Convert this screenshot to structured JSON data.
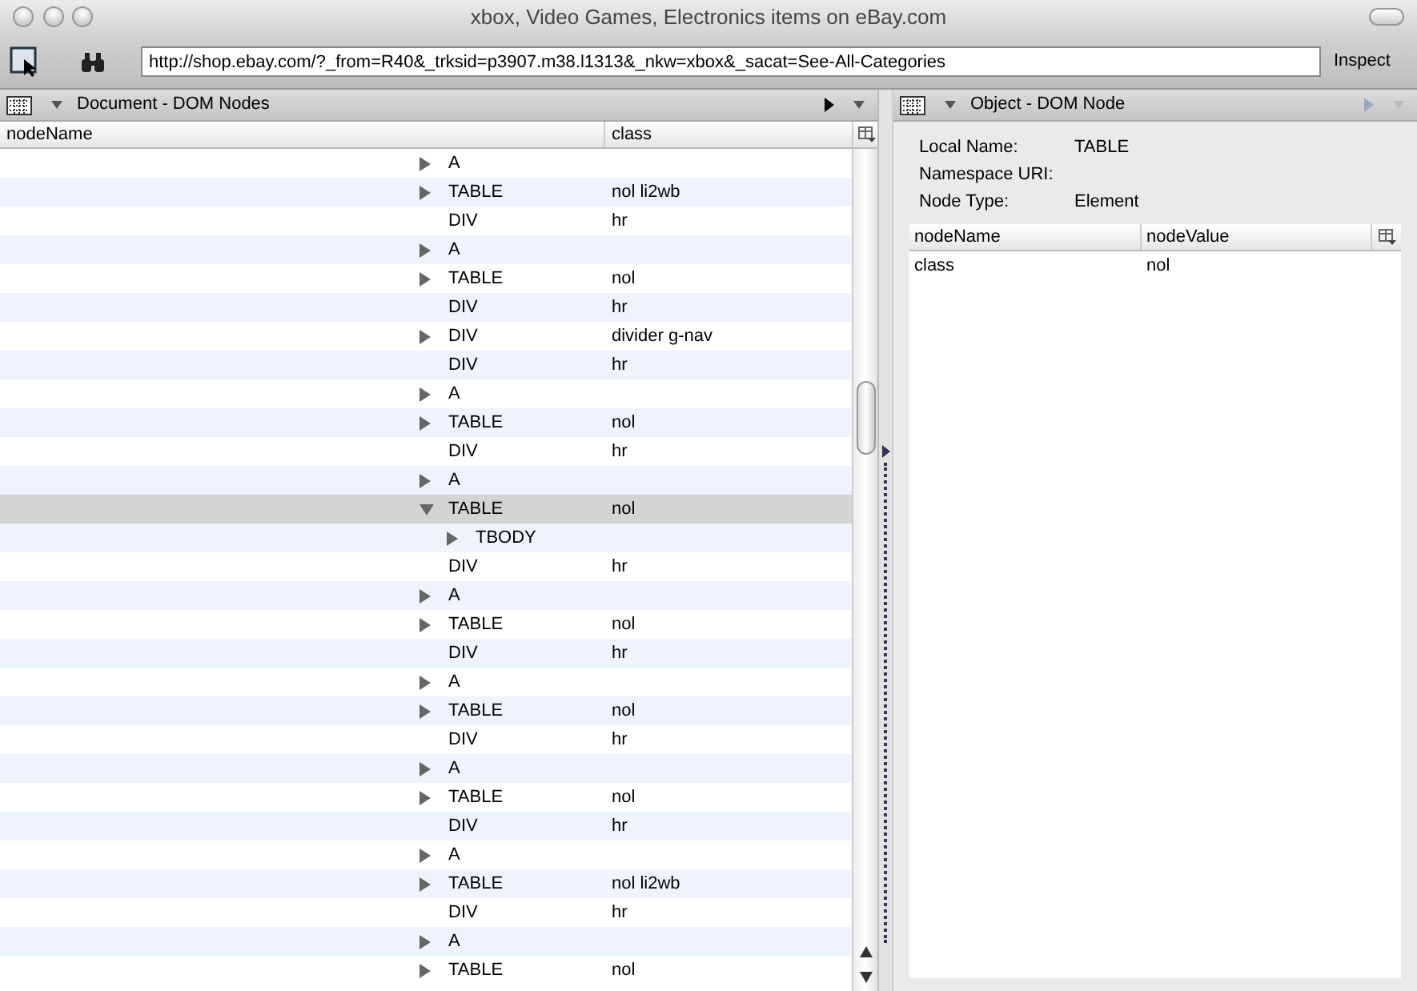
{
  "window": {
    "title": "xbox, Video Games, Electronics items on eBay.com"
  },
  "toolbar": {
    "url": "http://shop.ebay.com/?_from=R40&_trksid=p3907.m38.l1313&_nkw=xbox&_sacat=See-All-Categories",
    "inspect_label": "Inspect"
  },
  "left_pane": {
    "title": "Document - DOM Nodes",
    "columns": [
      "nodeName",
      "class"
    ],
    "rows": [
      {
        "node": "A",
        "kind": "branch",
        "expanded": false,
        "selected": false
      },
      {
        "node": "TABLE",
        "class": "nol li2wb",
        "kind": "branch",
        "expanded": false,
        "selected": false
      },
      {
        "node": "DIV",
        "class": "hr",
        "kind": "leaf",
        "selected": false
      },
      {
        "node": "A",
        "kind": "branch",
        "expanded": false,
        "selected": false
      },
      {
        "node": "TABLE",
        "class": "nol",
        "kind": "branch",
        "expanded": false,
        "selected": false
      },
      {
        "node": "DIV",
        "class": "hr",
        "kind": "leaf",
        "selected": false
      },
      {
        "node": "DIV",
        "class": "divider g-nav",
        "kind": "branch",
        "expanded": false,
        "selected": false
      },
      {
        "node": "DIV",
        "class": "hr",
        "kind": "leaf",
        "selected": false
      },
      {
        "node": "A",
        "kind": "branch",
        "expanded": false,
        "selected": false
      },
      {
        "node": "TABLE",
        "class": "nol",
        "kind": "branch",
        "expanded": false,
        "selected": false
      },
      {
        "node": "DIV",
        "class": "hr",
        "kind": "leaf",
        "selected": false
      },
      {
        "node": "A",
        "kind": "branch",
        "expanded": false,
        "selected": false
      },
      {
        "node": "TABLE",
        "class": "nol",
        "kind": "branch",
        "expanded": true,
        "selected": true,
        "children": [
          {
            "node": "TBODY",
            "kind": "branch",
            "expanded": false,
            "selected": false
          }
        ]
      },
      {
        "node": "DIV",
        "class": "hr",
        "kind": "leaf",
        "selected": false
      },
      {
        "node": "A",
        "kind": "branch",
        "expanded": false,
        "selected": false
      },
      {
        "node": "TABLE",
        "class": "nol",
        "kind": "branch",
        "expanded": false,
        "selected": false
      },
      {
        "node": "DIV",
        "class": "hr",
        "kind": "leaf",
        "selected": false
      },
      {
        "node": "A",
        "kind": "branch",
        "expanded": false,
        "selected": false
      },
      {
        "node": "TABLE",
        "class": "nol",
        "kind": "branch",
        "expanded": false,
        "selected": false
      },
      {
        "node": "DIV",
        "class": "hr",
        "kind": "leaf",
        "selected": false
      },
      {
        "node": "A",
        "kind": "branch",
        "expanded": false,
        "selected": false
      },
      {
        "node": "TABLE",
        "class": "nol",
        "kind": "branch",
        "expanded": false,
        "selected": false
      },
      {
        "node": "DIV",
        "class": "hr",
        "kind": "leaf",
        "selected": false
      },
      {
        "node": "A",
        "kind": "branch",
        "expanded": false,
        "selected": false
      },
      {
        "node": "TABLE",
        "class": "nol li2wb",
        "kind": "branch",
        "expanded": false,
        "selected": false
      },
      {
        "node": "DIV",
        "class": "hr",
        "kind": "leaf",
        "selected": false
      },
      {
        "node": "A",
        "kind": "branch",
        "expanded": false,
        "selected": false
      },
      {
        "node": "TABLE",
        "class": "nol",
        "kind": "branch",
        "expanded": false,
        "selected": false
      }
    ]
  },
  "right_pane": {
    "title": "Object - DOM Node",
    "properties": [
      {
        "label": "Local Name:",
        "value": "TABLE"
      },
      {
        "label": "Namespace URI:"
      },
      {
        "label": "Node Type:",
        "value": "Element"
      }
    ],
    "columns": [
      "nodeName",
      "nodeValue"
    ],
    "rows": [
      {
        "name": "class",
        "value": "nol"
      }
    ]
  }
}
